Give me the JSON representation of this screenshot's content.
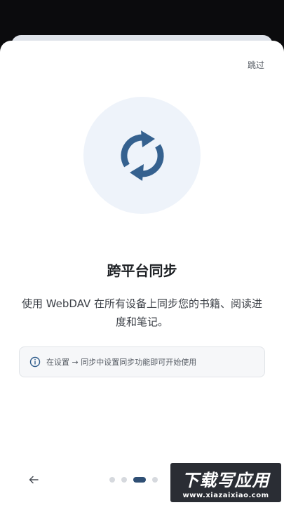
{
  "onboarding": {
    "skip_label": "跳过",
    "icon": "sync-icon",
    "title": "跨平台同步",
    "description": "使用 WebDAV 在所有设备上同步您的书籍、阅读进度和笔记。",
    "hint": {
      "icon": "info-icon",
      "text": "在设置 → 同步中设置同步功能即可开始使用"
    },
    "pager": {
      "total": 4,
      "current": 3
    },
    "back_icon": "arrow-left-icon"
  },
  "watermark": {
    "main": "下载写应用",
    "sub": "www.xiazaixiao.com"
  },
  "colors": {
    "accent": "#2f4f74",
    "icon": "#35618f",
    "hero_bg": "#eef3fa"
  }
}
